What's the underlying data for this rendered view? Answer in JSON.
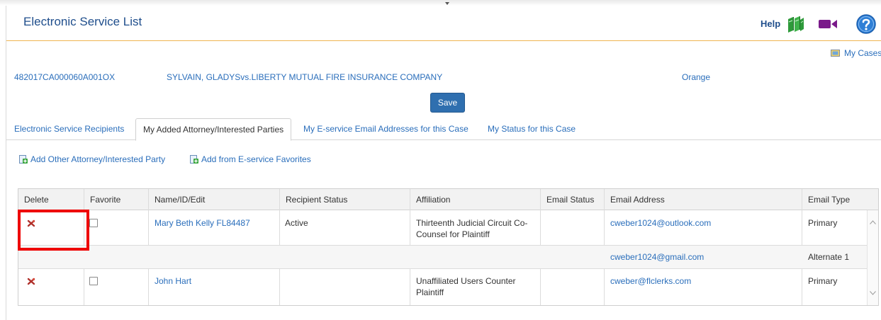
{
  "header": {
    "title": "Electronic Service List",
    "help_label": "Help",
    "my_cases_label": "My Cases"
  },
  "case": {
    "number": "482017CA000060A001OX",
    "title": "SYLVAIN, GLADYSvs.LIBERTY MUTUAL FIRE INSURANCE COMPANY",
    "county": "Orange",
    "save_label": "Save"
  },
  "tabs": [
    {
      "label": "Electronic Service Recipients",
      "active": false
    },
    {
      "label": "My Added Attorney/Interested Parties",
      "active": true
    },
    {
      "label": "My E-service Email Addresses for this Case",
      "active": false
    },
    {
      "label": "My Status for this Case",
      "active": false
    }
  ],
  "actions": {
    "add_other": "Add Other Attorney/Interested Party",
    "add_favorites": "Add from E-service Favorites"
  },
  "table": {
    "columns": [
      "Delete",
      "Favorite",
      "Name/ID/Edit",
      "Recipient Status",
      "Affiliation",
      "Email Status",
      "Email Address",
      "Email Type"
    ],
    "rows": [
      {
        "name": "Mary Beth Kelly FL84487",
        "status": "Active",
        "affiliation": "Thirteenth Judicial Circuit Co-Counsel for Plaintiff",
        "email_status": "",
        "emails": [
          {
            "address": "cweber1024@outlook.com",
            "type": "Primary"
          },
          {
            "address": "cweber1024@gmail.com",
            "type": "Alternate 1"
          }
        ]
      },
      {
        "name": "John Hart",
        "status": "",
        "affiliation": "Unaffiliated Users Counter Plaintiff",
        "email_status": "",
        "emails": [
          {
            "address": "cweber@flclerks.com",
            "type": "Primary"
          }
        ]
      }
    ]
  },
  "icons": {
    "delete": "delete-x-icon",
    "books": "books-icon",
    "video": "video-camera-icon",
    "help": "question-circle-icon",
    "add": "add-green-plus-icon"
  },
  "colors": {
    "title": "#1f4e8c",
    "link": "#2a6ebb",
    "accent_rule": "#f0b451",
    "save_button": "#2f6faf",
    "highlight": "#ee0000",
    "delete_icon": "#b0302a"
  }
}
